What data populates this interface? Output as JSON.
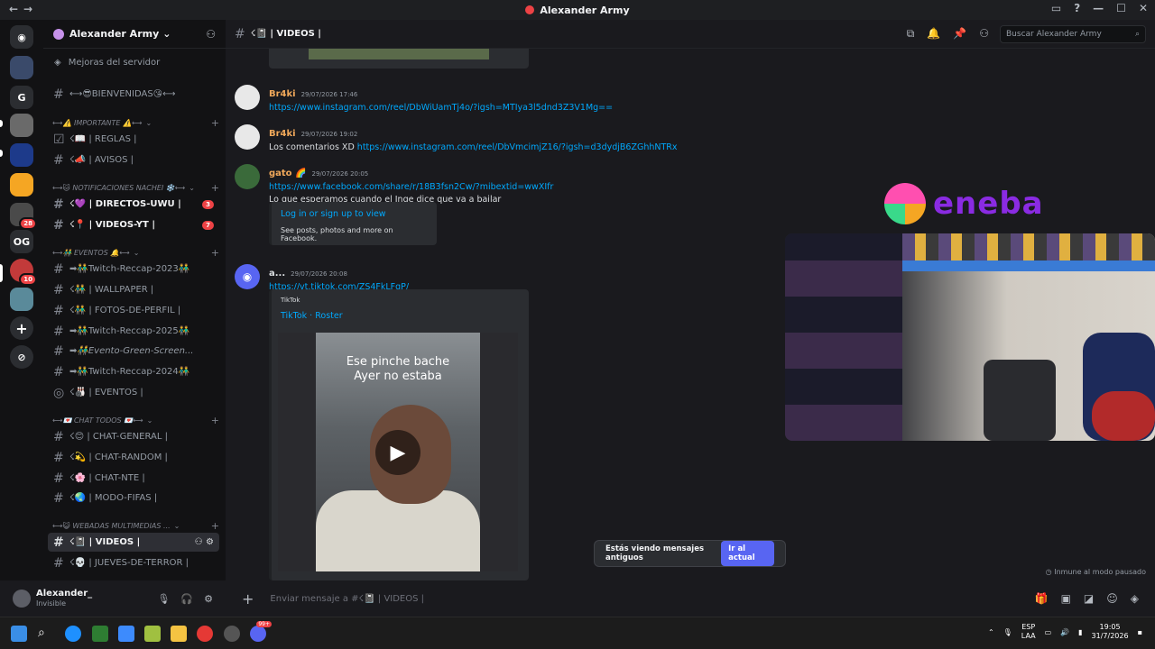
{
  "window": {
    "title": "Alexander Army"
  },
  "server": {
    "name": "Alexander Army",
    "boost_label": "Mejoras del servidor"
  },
  "guild_badges": {
    "g8": "28",
    "g10": "10"
  },
  "guild_letters": {
    "g": "G",
    "og": "OG"
  },
  "channels": [
    {
      "label": "⟷😎BIENVENIDAS😘⟷"
    },
    {
      "label": "☇📖 | REGLAS |"
    },
    {
      "label": "☇📣 | AVISOS |"
    },
    {
      "label": "☇💜 | DIRECTOS-UWU |",
      "badge": "3"
    },
    {
      "label": "☇📍 | VIDEOS-YT |",
      "badge": "7"
    },
    {
      "label": "➡👬Twitch-Reccap-2023👬"
    },
    {
      "label": "☇👬 | WALLPAPER |"
    },
    {
      "label": "☇👬 | FOTOS-DE-PERFIL |"
    },
    {
      "label": "➡👬Twitch-Reccap-2025👬"
    },
    {
      "label": "➡👬Evento-Green-Screen..."
    },
    {
      "label": "➡👬Twitch-Reccap-2024👬"
    },
    {
      "label": "☇🎳 | EVENTOS |"
    },
    {
      "label": "☇😊 | CHAT-GENERAL |"
    },
    {
      "label": "☇💫 | CHAT-RANDOM |"
    },
    {
      "label": "☇🌸 | CHAT-NTE |"
    },
    {
      "label": "☇🌏 | MODO-FIFAS |"
    },
    {
      "label": "☇📓 | VIDEOS |"
    },
    {
      "label": "☇💀 | JUEVES-DE-TERROR |"
    }
  ],
  "categories": [
    {
      "label": "⟷⚠️ IMPORTANTE ⚠️⟷"
    },
    {
      "label": "⟷🐱 NOTIFICACIONES NACHEI ❄️⟷"
    },
    {
      "label": "⟷👬 EVENTOS 🔔⟷"
    },
    {
      "label": "⟷💌 CHAT TODOS 💌⟷"
    },
    {
      "label": "⟷😺 WEBADAS MULTIMEDIAS ..."
    }
  ],
  "user": {
    "name": "Alexander_",
    "status": "Invisible"
  },
  "header": {
    "channel_name": "☇📓 | VIDEOS |",
    "search_placeholder": "Buscar Alexander Army"
  },
  "messages": [
    {
      "author": "Br4ki",
      "time": "29/07/2026 17:46",
      "link": "https://www.instagram.com/reel/DbWiUamTj4o/?igsh=MTIya3l5dnd3Z3V1Mg=="
    },
    {
      "author": "Br4ki",
      "time": "29/07/2026 19:02",
      "text": "Los comentarios XD",
      "link": "https://www.instagram.com/reel/DbVmcimjZ16/?igsh=d3dydjB6ZGhhNTRx"
    },
    {
      "author": "gato 🌈",
      "time": "29/07/2026 20:05",
      "link": "https://www.facebook.com/share/r/18B3fsn2Cw/?mibextid=wwXIfr",
      "text": "Lo que esperamos cuando el Inge dice que va a bailar"
    },
    {
      "author": "a...",
      "time": "29/07/2026 20:08",
      "link": "https://vt.tiktok.com/ZS4FkLFgP/"
    }
  ],
  "fb_embed": {
    "title": "Log in or sign up to view",
    "desc": "See posts, photos and more on Facebook."
  },
  "tiktok_embed": {
    "provider": "TikTok",
    "title": "TikTok · Roster",
    "video_caption_1": "Ese pinche bache",
    "video_caption_2": "Ayer no estaba"
  },
  "overlay": {
    "brand": "eneba"
  },
  "toast": {
    "text": "Estás viendo mensajes antiguos",
    "button": "Ir al actual"
  },
  "immune": "Inmune al modo pausado",
  "composer": {
    "placeholder": "Enviar mensaje a #☇📓 | VIDEOS |"
  },
  "taskbar": {
    "lang1": "ESP",
    "lang2": "LAA",
    "time": "19:05",
    "date": "31/7/2026",
    "discord_badge": "99+"
  }
}
